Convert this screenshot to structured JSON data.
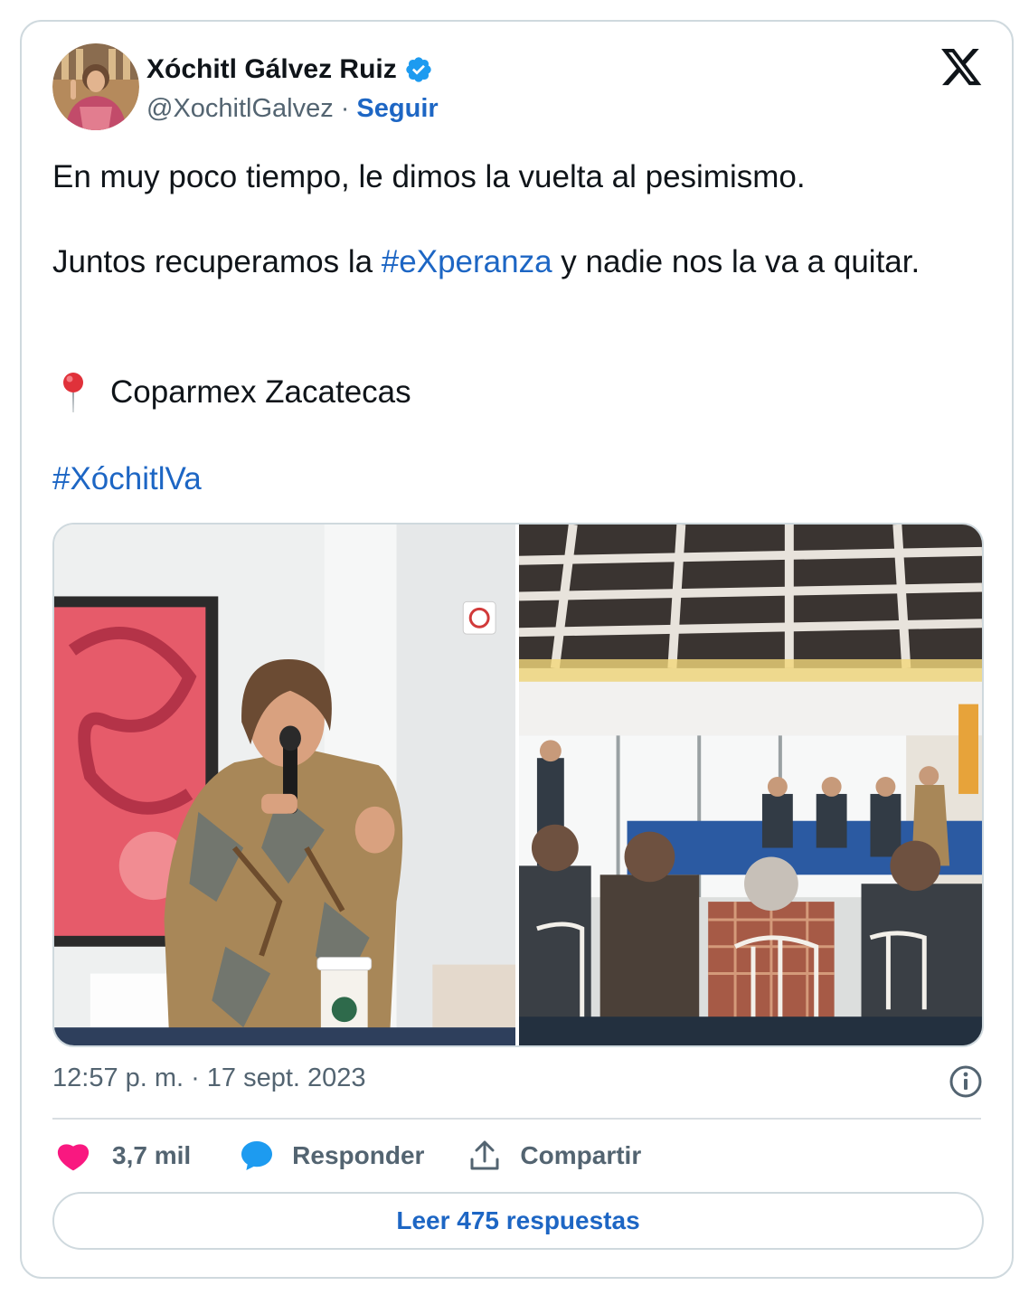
{
  "author": {
    "name": "Xóchitl Gálvez Ruiz",
    "handle": "@XochitlGalvez",
    "separator": "·",
    "follow_label": "Seguir",
    "verified_icon": "verified-badge-icon",
    "logo_icon": "x-logo-icon"
  },
  "tweet": {
    "line1": "En muy poco tiempo, le dimos la vuelta al pesimismo.",
    "line2_before": "Juntos recuperamos la ",
    "line2_hashtag": "#eXperanza",
    "line2_after": " y nadie nos la va a quitar.",
    "location_icon": "round-pushpin-icon",
    "location": "Coparmex Zacatecas",
    "hashtag": "#XóchitlVa"
  },
  "media": {
    "photos": [
      "woman-speaking-with-microphone-photo",
      "meeting-room-audience-photo"
    ]
  },
  "meta": {
    "time": "12:57 p. m.",
    "separator": "·",
    "date": "17 sept. 2023",
    "info_icon": "info-icon"
  },
  "actions": {
    "likes": "3,7 mil",
    "reply_label": "Responder",
    "share_label": "Compartir"
  },
  "read_replies_label": "Leer 475 respuestas",
  "colors": {
    "link": "#1d66c4",
    "like": "#f91880",
    "reply": "#1d9bf0",
    "secondary": "#536471",
    "border": "#cfd9de"
  }
}
